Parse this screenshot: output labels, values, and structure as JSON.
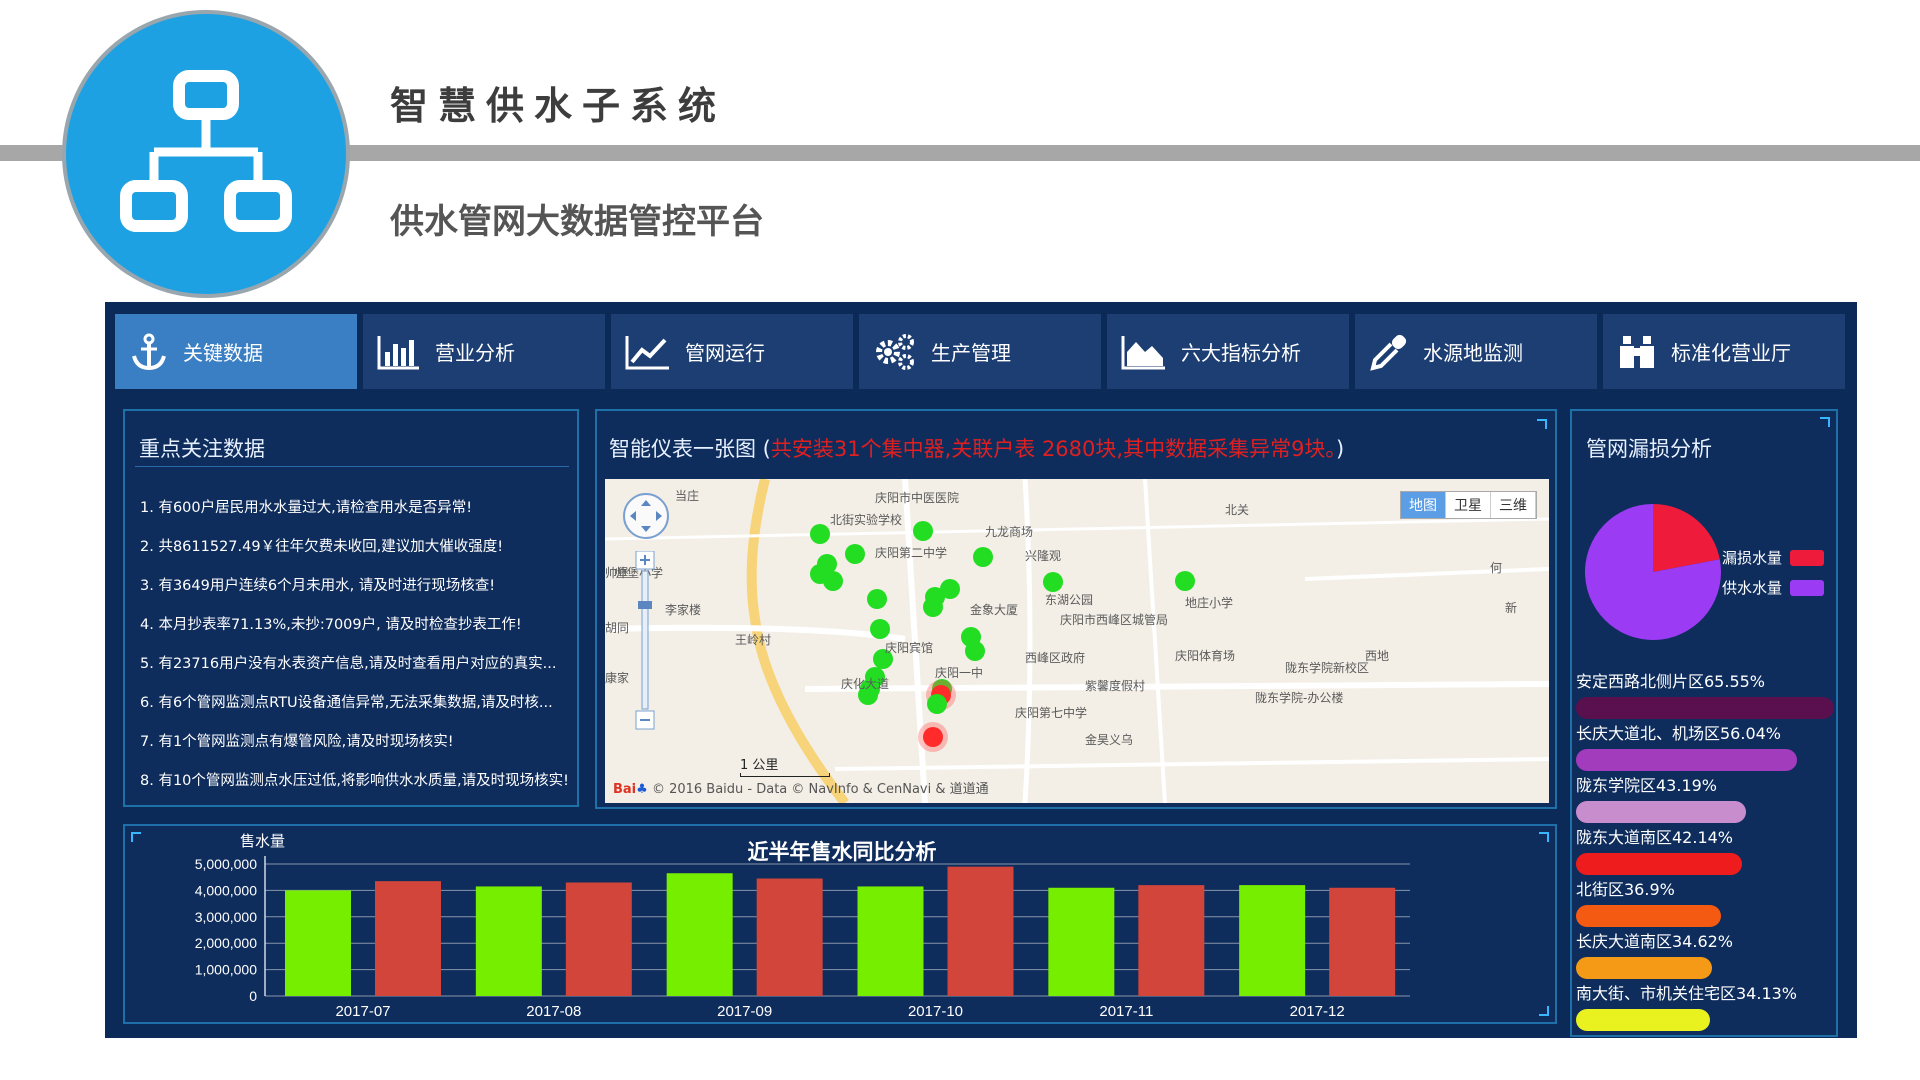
{
  "header": {
    "subtitle": "智慧供水子系统",
    "title": "供水管网大数据管控平台"
  },
  "tabs": [
    {
      "label": "关键数据",
      "icon": "anchor-icon",
      "active": true
    },
    {
      "label": "营业分析",
      "icon": "bar-chart-icon",
      "active": false
    },
    {
      "label": "管网运行",
      "icon": "line-chart-icon",
      "active": false
    },
    {
      "label": "生产管理",
      "icon": "gears-icon",
      "active": false
    },
    {
      "label": "六大指标分析",
      "icon": "area-chart-icon",
      "active": false
    },
    {
      "label": "水源地监测",
      "icon": "eyedropper-icon",
      "active": false
    },
    {
      "label": "标准化营业厅",
      "icon": "binoculars-icon",
      "active": false
    }
  ],
  "focus": {
    "title": "重点关注数据",
    "items": [
      "1. 有600户居民用水水量过大,请检查用水是否异常!",
      "2. 共8611527.49￥往年欠费未收回,建议加大催收强度!",
      "3. 有3649用户连续6个月未用水, 请及时进行现场核查!",
      "4. 本月抄表率71.13%,未抄:7009户, 请及时检查抄表工作!",
      "5. 有23716用户没有水表资产信息,请及时查看用户对应的真实...",
      "6. 有6个管网监测点RTU设备通信异常,无法采集数据,请及时核...",
      "7. 有1个管网监测点有爆管风险,请及时现场核实!",
      "8. 有10个管网监测点水压过低,将影响供水水质量,请及时现场核实!"
    ]
  },
  "map": {
    "title_prefix": "智能仪表一张图 (",
    "title_warning": "共安装31个集中器,关联户表 2680块,其中数据采集异常9块。",
    "title_suffix": ")",
    "switch": [
      "地图",
      "卫星",
      "三维"
    ],
    "scale": "1 公里",
    "footer": "© 2016 Baidu - Data © NavInfo & CenNavi & 道道通",
    "labels": [
      "当庄",
      "庆阳市中医医院",
      "北街实验学校",
      "九龙商场",
      "兴隆观",
      "庆阳第二中学",
      "北关",
      "帅堡小学",
      "李家楼",
      "金象大厦",
      "东湖公园",
      "地庄小学",
      "庆阳市西峰区城管局",
      "王岭村",
      "庆阳宾馆",
      "西峰区政府",
      "庆阳体育场",
      "陇东学院新校区",
      "庆阳一中",
      "紫馨度假村",
      "陇东学院-办公楼",
      "庆阳第七中学",
      "金昊义乌",
      "西地",
      "新",
      "何",
      "帅堡",
      "胡同",
      "康家",
      "庆化大道"
    ],
    "points_total": 31
  },
  "loss": {
    "title": "管网漏损分析",
    "legend": [
      {
        "label": "漏损水量",
        "color": "#ee1c3a"
      },
      {
        "label": "供水水量",
        "color": "#9b3bf3"
      }
    ],
    "pie": {
      "leak_fraction": 0.22
    },
    "bars": [
      {
        "label": "安定西路北侧片区65.55%",
        "value": 65.55,
        "color": "#5a0f4e"
      },
      {
        "label": "长庆大道北、机场区56.04%",
        "value": 56.04,
        "color": "#a33bbd"
      },
      {
        "label": "陇东学院区43.19%",
        "value": 43.19,
        "color": "#c88dcc"
      },
      {
        "label": "陇东大道南区42.14%",
        "value": 42.14,
        "color": "#ee1c1c"
      },
      {
        "label": "北街区36.9%",
        "value": 36.9,
        "color": "#f45a11"
      },
      {
        "label": "长庆大道南区34.62%",
        "value": 34.62,
        "color": "#f59a16"
      },
      {
        "label": "南大街、市机关住宅区34.13%",
        "value": 34.13,
        "color": "#e9f21e"
      }
    ]
  },
  "chart_data": {
    "type": "bar",
    "title": "近半年售水同比分析",
    "ylabel": "售水量",
    "categories": [
      "2017-07",
      "2017-08",
      "2017-09",
      "2017-10",
      "2017-11",
      "2017-12"
    ],
    "series": [
      {
        "values": [
          4000000,
          4150000,
          4650000,
          4150000,
          4100000,
          4200000
        ],
        "color": "#76ee00"
      },
      {
        "values": [
          4350000,
          4300000,
          4450000,
          4900000,
          4200000,
          4100000
        ],
        "color": "#d1453b"
      }
    ],
    "ylim": [
      0,
      5000000
    ],
    "yticks": [
      "0",
      "1,000,000",
      "2,000,000",
      "3,000,000",
      "4,000,000",
      "5,000,000"
    ],
    "grid": true
  }
}
